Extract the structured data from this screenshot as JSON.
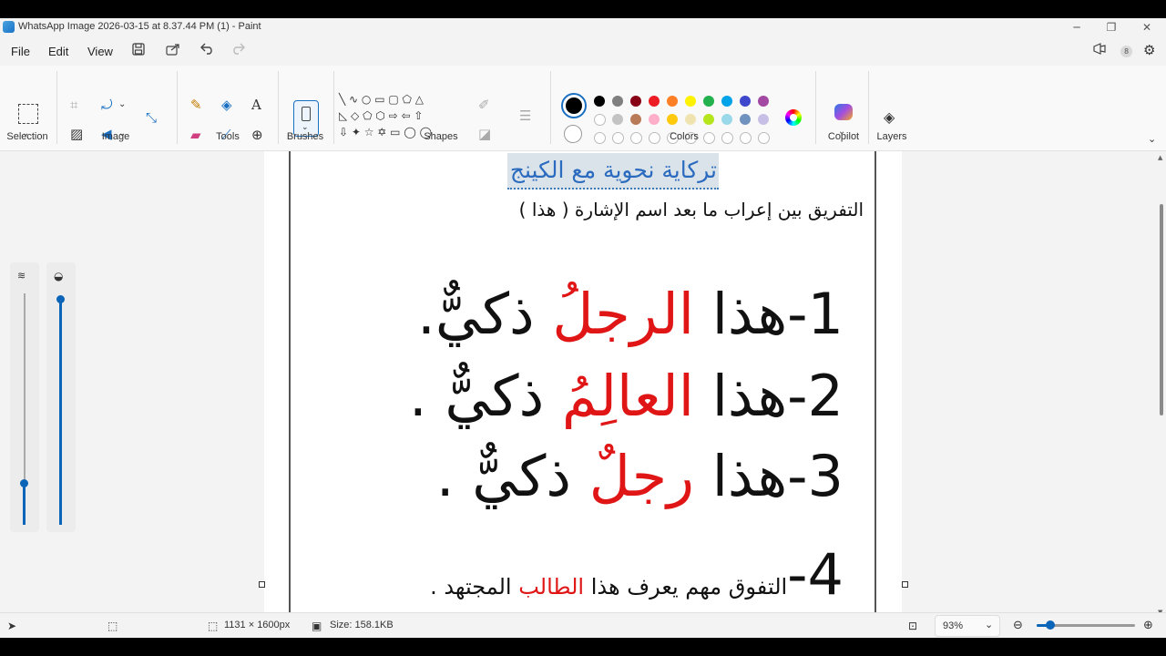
{
  "window": {
    "title": "WhatsApp Image 2026-03-15 at 8.37.44 PM (1) - Paint"
  },
  "menu": {
    "file": "File",
    "edit": "Edit",
    "view": "View"
  },
  "ribbon": {
    "groups": {
      "selection": "Selection",
      "image": "Image",
      "tools": "Tools",
      "brushes": "Brushes",
      "shapes": "Shapes",
      "colors": "Colors",
      "copilot": "Copilot",
      "layers": "Layers"
    },
    "palette_row1": [
      "#000000",
      "#7f7f7f",
      "#880015",
      "#ed1c24",
      "#ff7f27",
      "#fff200",
      "#22b14c",
      "#00a2e8",
      "#3f48cc",
      "#a349a4"
    ],
    "palette_row2": [
      "#ffffff",
      "#c3c3c3",
      "#b97a57",
      "#ffaec9",
      "#ffc90e",
      "#efe4b0",
      "#b5e61d",
      "#99d9ea",
      "#7092be",
      "#c8bfe7"
    ],
    "primary_color": "#000000",
    "secondary_color": "#ffffff"
  },
  "document": {
    "title": "تركاية نحوية مع الكينج",
    "subtitle": "التفريق بين إعراب ما بعد اسم الإشارة ( هذا )",
    "line1": {
      "num": "1-",
      "pre": "هذا ",
      "red": "الرجلُ",
      "post": " ذكيٌّ."
    },
    "line2": {
      "num": "2-",
      "pre": "هذا ",
      "red": "العالِمُ",
      "post": " ذكيٌّ ."
    },
    "line3": {
      "num": "3-",
      "pre": "هذا ",
      "red": "رجلٌ",
      "post": " ذكيٌّ ."
    },
    "line4": {
      "num": "4-",
      "pre": "التفوق مهم يعرف هذا ",
      "red": "الطالب",
      "post": " المجتهد ."
    }
  },
  "status": {
    "dimensions": "1131 × 1600px",
    "size": "Size: 158.1KB",
    "zoom": "93%",
    "zoom_level": 0.4
  },
  "badge": {
    "count": "8"
  },
  "icons": [
    "select-rectangle-icon",
    "crop-icon",
    "rotate-icon",
    "resize-icon",
    "pencil-icon",
    "fill-icon",
    "text-icon",
    "eraser-icon",
    "color-picker-icon",
    "magnifier-icon",
    "brush-icon",
    "copilot-icon",
    "layers-icon",
    "save-icon",
    "share-icon",
    "undo-icon",
    "redo-icon",
    "settings-icon"
  ]
}
